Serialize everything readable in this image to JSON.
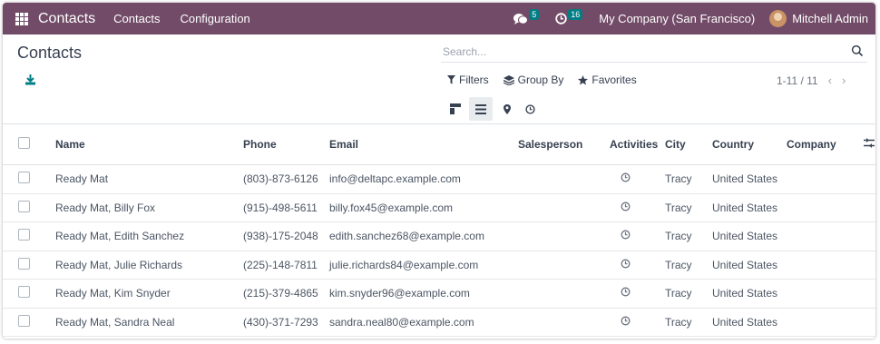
{
  "navbar": {
    "brand": "Contacts",
    "menu": [
      "Contacts",
      "Configuration"
    ],
    "messages_count": "5",
    "activities_count": "16",
    "company": "My Company (San Francisco)",
    "user": "Mitchell Admin",
    "bg_color": "#714b67",
    "badge_color": "#017e84"
  },
  "control_panel": {
    "title": "Contacts",
    "search_placeholder": "Search...",
    "filters_label": "Filters",
    "group_by_label": "Group By",
    "favorites_label": "Favorites",
    "pager": "1-11 / 11",
    "views": [
      "kanban-icon",
      "list-icon",
      "map-icon",
      "activity-icon"
    ],
    "active_view": "list"
  },
  "table": {
    "columns": [
      "Name",
      "Phone",
      "Email",
      "Salesperson",
      "Activities",
      "City",
      "Country",
      "Company"
    ],
    "rows": [
      {
        "name": "Ready Mat",
        "phone": "(803)-873-6126",
        "email": "info@deltapc.example.com",
        "salesperson": "",
        "city": "Tracy",
        "country": "United States",
        "company": ""
      },
      {
        "name": "Ready Mat, Billy Fox",
        "phone": "(915)-498-5611",
        "email": "billy.fox45@example.com",
        "salesperson": "",
        "city": "Tracy",
        "country": "United States",
        "company": ""
      },
      {
        "name": "Ready Mat, Edith Sanchez",
        "phone": "(938)-175-2048",
        "email": "edith.sanchez68@example.com",
        "salesperson": "",
        "city": "Tracy",
        "country": "United States",
        "company": ""
      },
      {
        "name": "Ready Mat, Julie Richards",
        "phone": "(225)-148-7811",
        "email": "julie.richards84@example.com",
        "salesperson": "",
        "city": "Tracy",
        "country": "United States",
        "company": ""
      },
      {
        "name": "Ready Mat, Kim Snyder",
        "phone": "(215)-379-4865",
        "email": "kim.snyder96@example.com",
        "salesperson": "",
        "city": "Tracy",
        "country": "United States",
        "company": ""
      },
      {
        "name": "Ready Mat, Sandra Neal",
        "phone": "(430)-371-7293",
        "email": "sandra.neal80@example.com",
        "salesperson": "",
        "city": "Tracy",
        "country": "United States",
        "company": ""
      }
    ]
  }
}
